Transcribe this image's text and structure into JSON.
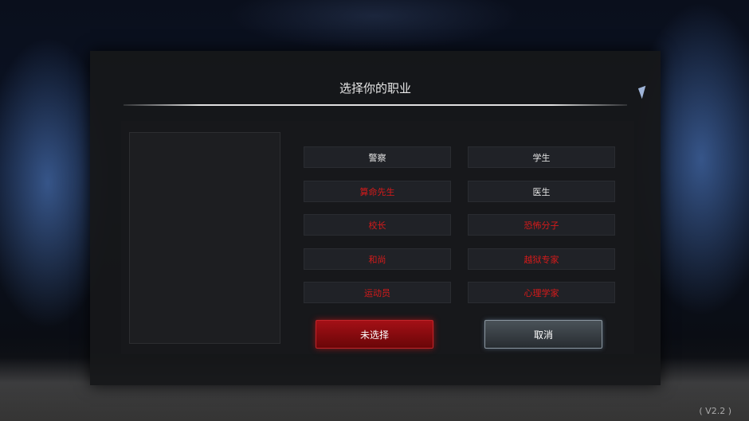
{
  "dialog": {
    "title": "选择你的职业",
    "jobs_left": [
      {
        "label": "警察",
        "available": true
      },
      {
        "label": "算命先生",
        "available": false
      },
      {
        "label": "校长",
        "available": false
      },
      {
        "label": "和尚",
        "available": false
      },
      {
        "label": "运动员",
        "available": false
      }
    ],
    "jobs_right": [
      {
        "label": "学生",
        "available": true
      },
      {
        "label": "医生",
        "available": true
      },
      {
        "label": "恐怖分子",
        "available": false
      },
      {
        "label": "越狱专家",
        "available": false
      },
      {
        "label": "心理学家",
        "available": false
      }
    ],
    "confirm_label": "未选择",
    "cancel_label": "取消"
  },
  "footer": {
    "version": "( V2.2 )"
  },
  "colors": {
    "locked": "#d61a1a",
    "available": "#e6e6e6",
    "confirm": "#a41016"
  }
}
